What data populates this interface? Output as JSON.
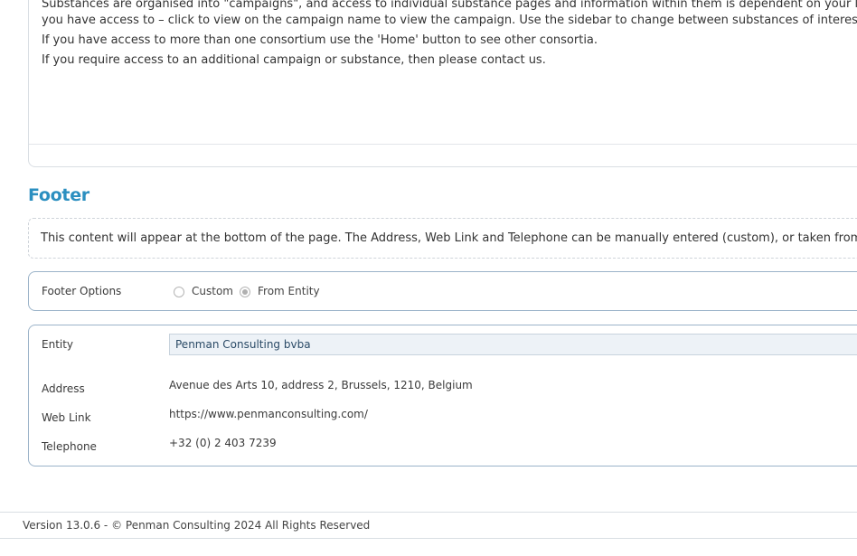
{
  "intro": {
    "line1": "Substances are organised into \"campaigns\", and access to individual substance pages and information within them is dependent on your log-in credentials.",
    "line2": "you have access to – click to view on the campaign name to view the campaign. Use the sidebar to change between substances of interest within the",
    "line3": "If you have access to more than one consortium use the 'Home' button to see other consortia.",
    "line4": "If you require access to an additional campaign or substance, then please contact us."
  },
  "footer_section": {
    "title": "Footer",
    "info": "This content will appear at the bottom of the page. The Address, Web Link and Telephone can be manually entered (custom), or taken from an entity."
  },
  "footer_options": {
    "label": "Footer Options",
    "options": [
      {
        "label": "Custom",
        "checked": false
      },
      {
        "label": "From Entity",
        "checked": true
      }
    ]
  },
  "details": {
    "entity_label": "Entity",
    "entity_value": "Penman Consulting bvba",
    "address_label": "Address",
    "address_value": "Avenue des Arts 10, address 2, Brussels, 1210, Belgium",
    "weblink_label": "Web Link",
    "weblink_value": "https://www.penmanconsulting.com/",
    "telephone_label": "Telephone",
    "telephone_value": "+32 (0) 2 403 7239"
  },
  "version": {
    "text": "Version 13.0.6 - © Penman Consulting 2024 All Rights Reserved"
  }
}
